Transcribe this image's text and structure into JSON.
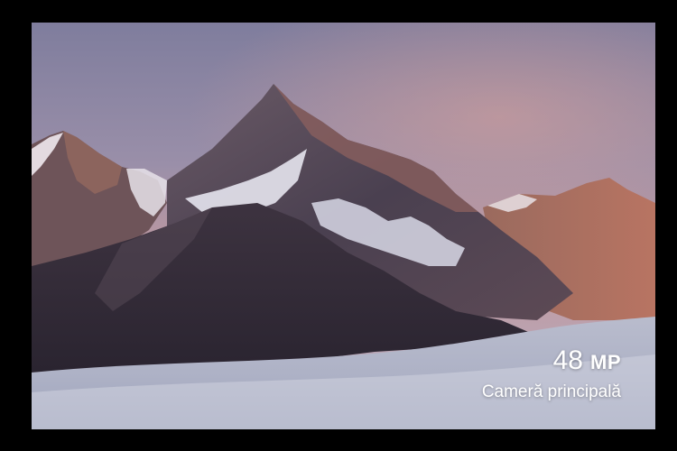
{
  "caption": {
    "megapixels": "48",
    "unit": "MP",
    "label": "Cameră principală"
  },
  "colors": {
    "background": "#000000",
    "sky_top": "#8f8aa8",
    "sky_glow": "#c89a9e",
    "cloud_sea": "#c9cbd9",
    "caption_text": "#ffffff"
  }
}
